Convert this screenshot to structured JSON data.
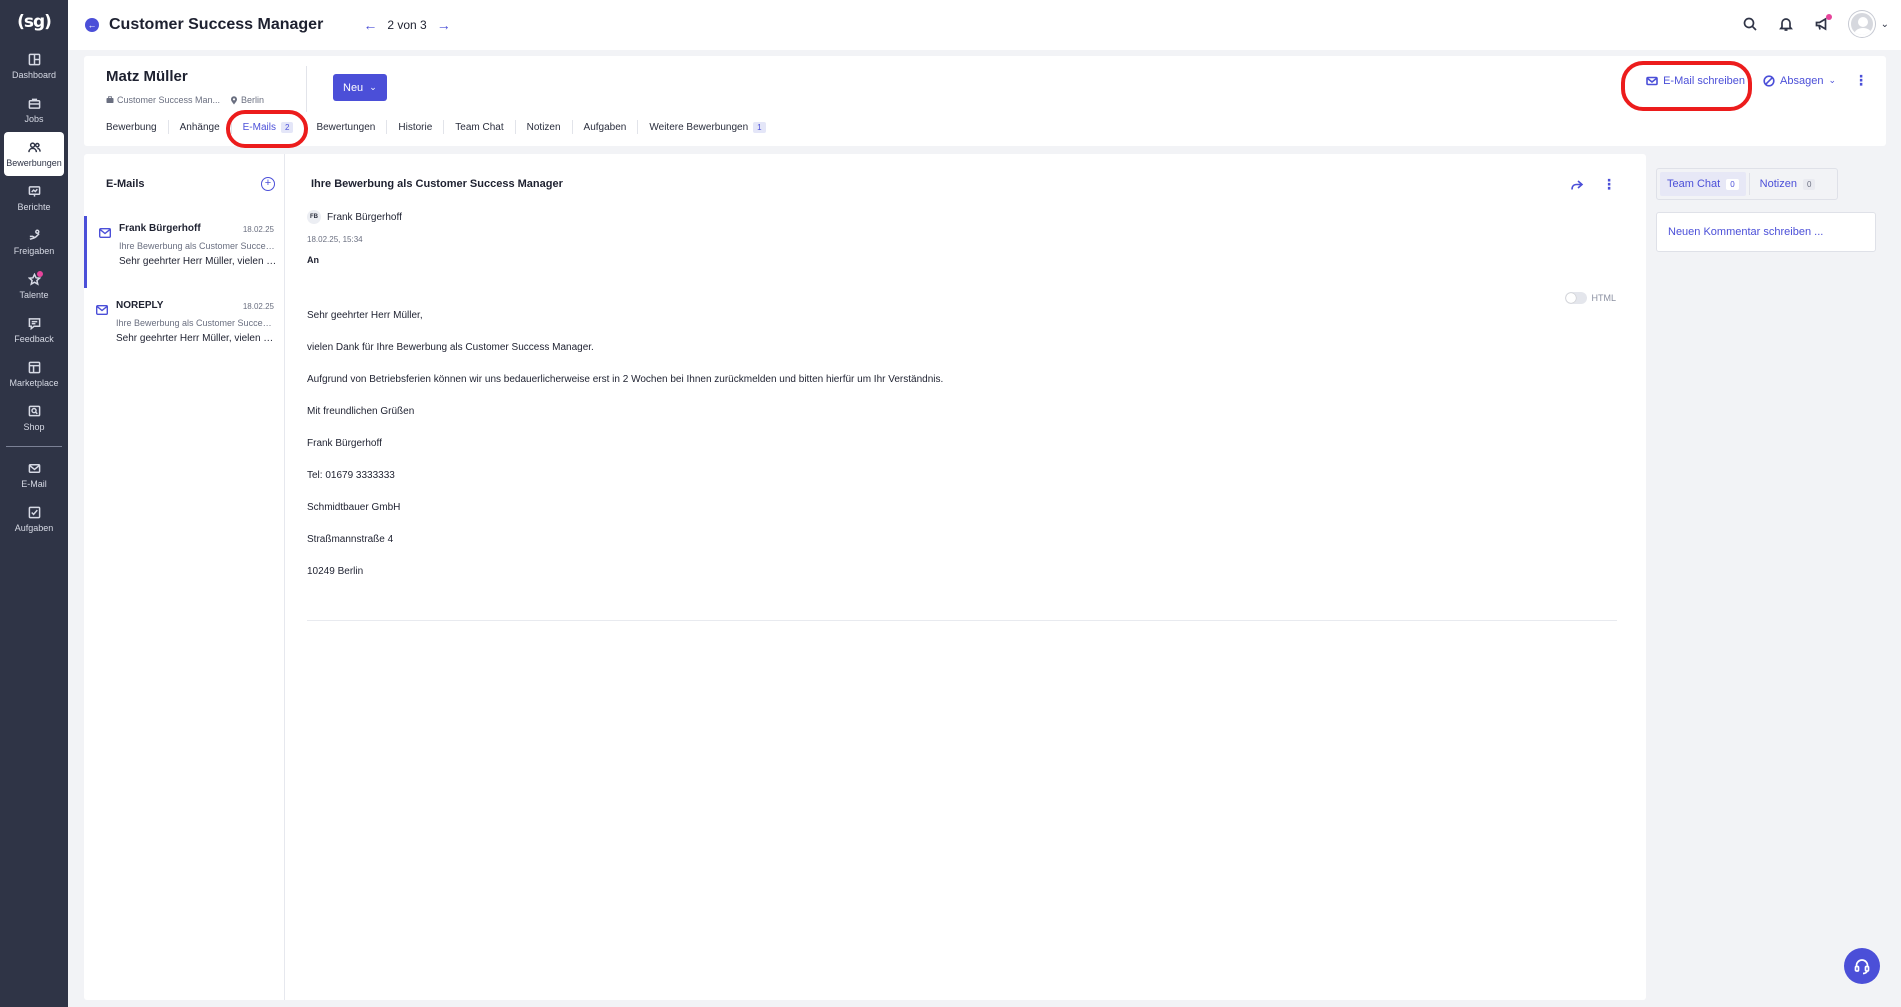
{
  "brand": {
    "logo_text": "(sg)"
  },
  "sidebar": {
    "items": [
      {
        "label": "Dashboard"
      },
      {
        "label": "Jobs"
      },
      {
        "label": "Bewerbungen"
      },
      {
        "label": "Berichte"
      },
      {
        "label": "Freigaben"
      },
      {
        "label": "Talente"
      },
      {
        "label": "Feedback"
      },
      {
        "label": "Marketplace"
      },
      {
        "label": "Shop"
      },
      {
        "label": "E-Mail"
      },
      {
        "label": "Aufgaben"
      }
    ]
  },
  "topbar": {
    "title": "Customer Success Manager",
    "pager": {
      "prev": "←",
      "text": "2 von 3",
      "next": "→"
    }
  },
  "candidate": {
    "name": "Matz Müller",
    "job": "Customer Success Man...",
    "location": "Berlin",
    "new_button": "Neu",
    "tabs": [
      {
        "label": "Bewerbung"
      },
      {
        "label": "Anhänge"
      },
      {
        "label": "E-Mails",
        "count": "2"
      },
      {
        "label": "Bewertungen"
      },
      {
        "label": "Historie"
      },
      {
        "label": "Team Chat"
      },
      {
        "label": "Notizen"
      },
      {
        "label": "Aufgaben"
      },
      {
        "label": "Weitere Bewerbungen",
        "count": "1"
      }
    ],
    "actions": {
      "write_email": "E-Mail schreiben",
      "reject": "Absagen"
    }
  },
  "email_list": {
    "title": "E-Mails",
    "items": [
      {
        "from": "Frank Bürgerhoff",
        "date": "18.02.25",
        "subject": "Ihre Bewerbung als Customer Success Manager",
        "preview": "Sehr geehrter Herr Müller, vielen Dank für Ihre Bewerbung"
      },
      {
        "from": "NOREPLY",
        "date": "18.02.25",
        "subject": "Ihre Bewerbung als Customer Success Manager",
        "preview": "Sehr geehrter Herr Müller, vielen Dank für Ihre Bewerbung"
      }
    ]
  },
  "email_view": {
    "subject": "Ihre Bewerbung als Customer Success Manager",
    "sender_initials": "FB",
    "sender": "Frank Bürgerhoff",
    "sent_at": "18.02.25, 15:34",
    "to_label": "An",
    "html_toggle_label": "HTML",
    "body": [
      "Sehr geehrter Herr Müller,",
      "vielen Dank für Ihre Bewerbung als Customer Success Manager.",
      "Aufgrund von Betriebsferien können wir uns bedauerlicherweise erst in 2 Wochen bei Ihnen zurückmelden und bitten hierfür um Ihr Verständnis.",
      "Mit freundlichen Grüßen",
      "Frank Bürgerhoff",
      "Tel: 01679 3333333",
      "Schmidtbauer GmbH",
      "Straßmannstraße 4",
      "10249 Berlin"
    ]
  },
  "right_panel": {
    "tabs": [
      {
        "label": "Team Chat",
        "count": "0"
      },
      {
        "label": "Notizen",
        "count": "0"
      }
    ],
    "comment_placeholder": "Neuen Kommentar schreiben ..."
  },
  "colors": {
    "accent": "#4b4fd8",
    "sidebar": "#2f3446",
    "annotation": "#ec1c1c",
    "badge": "#e6449b"
  }
}
